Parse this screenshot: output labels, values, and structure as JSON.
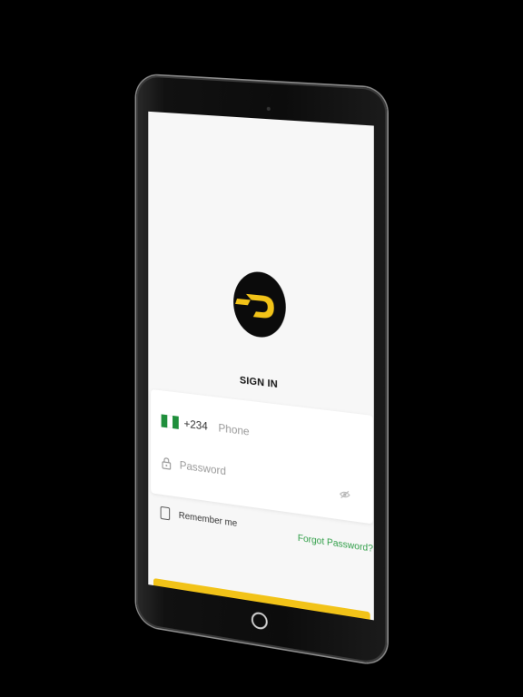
{
  "app": {
    "title": "SIGN IN"
  },
  "login_form": {
    "country_code": "+234",
    "phone_placeholder": "Phone",
    "password_placeholder": "Password",
    "remember_label": "Remember me",
    "forgot_label": "Forgot Password?"
  },
  "icons": {
    "flag": "nigeria-flag-icon",
    "lock": "lock-icon",
    "eye": "eye-slash-icon",
    "logo": "d-logo-icon"
  },
  "colors": {
    "brand_yellow": "#f2c318",
    "logo_black": "#0b0b0b",
    "link_green": "#2f9e47",
    "background": "#f7f7f7"
  }
}
